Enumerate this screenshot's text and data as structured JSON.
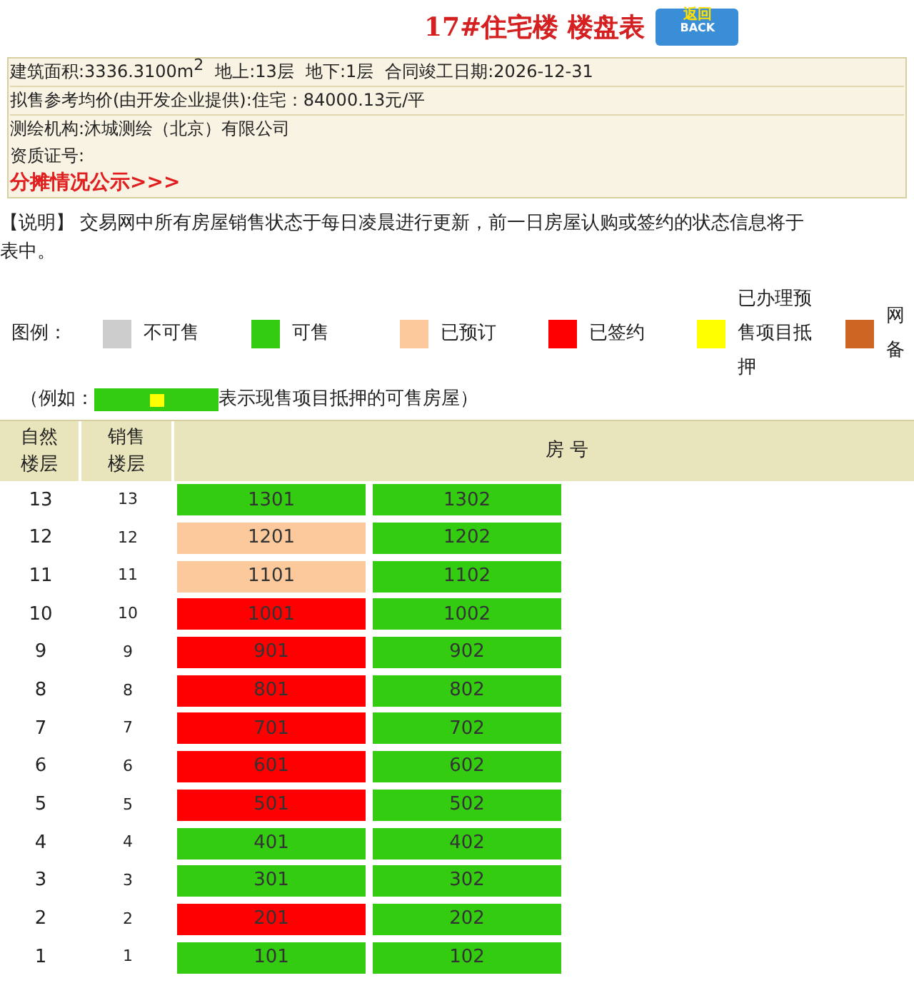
{
  "title": "17#住宅楼 楼盘表",
  "back_button": {
    "top": "返回",
    "bottom": "BACK"
  },
  "info": {
    "area_label": "建筑面积:3336.3100m",
    "area_sup": "2",
    "above": "地上:13层",
    "below": "地下:1层",
    "completion": "合同竣工日期:2026-12-31",
    "price": "拟售参考均价(由开发企业提供):住宅：84000.13元/平",
    "surveyor": "测绘机构:沐城测绘（北京）有限公司",
    "cert": "资质证号:",
    "link": "分摊情况公示>>>"
  },
  "notice": [
    "【说明】 交易网中所有房屋销售状态于每日凌晨进行更新，前一日房屋认购或签约的状态信息将于",
    "表中。"
  ],
  "legend": {
    "label": "图例：",
    "items": [
      {
        "label": "不可售",
        "color": "#cccccc"
      },
      {
        "label": "可售",
        "color": "#33cc11"
      },
      {
        "label": "已预订",
        "color": "#fbc99b"
      },
      {
        "label": "已签约",
        "color": "#ff0000"
      },
      {
        "label": "已办理预售项目抵押",
        "color": "#ffff00"
      },
      {
        "label": "网备",
        "color": "#cc6622"
      }
    ]
  },
  "example": {
    "prefix": "（例如：",
    "suffix": "表示现售项目抵押的可售房屋）"
  },
  "table": {
    "columns": [
      "自然楼层",
      "销售楼层",
      "房 号"
    ],
    "rows": [
      {
        "floor": "13",
        "sale_floor": "13",
        "rooms": [
          {
            "number": "1301",
            "color": "#33cc11"
          },
          {
            "number": "1302",
            "color": "#33cc11"
          }
        ]
      },
      {
        "floor": "12",
        "sale_floor": "12",
        "rooms": [
          {
            "number": "1201",
            "color": "#fbc99b"
          },
          {
            "number": "1202",
            "color": "#33cc11"
          }
        ]
      },
      {
        "floor": "11",
        "sale_floor": "11",
        "rooms": [
          {
            "number": "1101",
            "color": "#fbc99b"
          },
          {
            "number": "1102",
            "color": "#33cc11"
          }
        ]
      },
      {
        "floor": "10",
        "sale_floor": "10",
        "rooms": [
          {
            "number": "1001",
            "color": "#ff0000"
          },
          {
            "number": "1002",
            "color": "#33cc11"
          }
        ]
      },
      {
        "floor": "9",
        "sale_floor": "9",
        "rooms": [
          {
            "number": "901",
            "color": "#ff0000"
          },
          {
            "number": "902",
            "color": "#33cc11"
          }
        ]
      },
      {
        "floor": "8",
        "sale_floor": "8",
        "rooms": [
          {
            "number": "801",
            "color": "#ff0000"
          },
          {
            "number": "802",
            "color": "#33cc11"
          }
        ]
      },
      {
        "floor": "7",
        "sale_floor": "7",
        "rooms": [
          {
            "number": "701",
            "color": "#ff0000"
          },
          {
            "number": "702",
            "color": "#33cc11"
          }
        ]
      },
      {
        "floor": "6",
        "sale_floor": "6",
        "rooms": [
          {
            "number": "601",
            "color": "#ff0000"
          },
          {
            "number": "602",
            "color": "#33cc11"
          }
        ]
      },
      {
        "floor": "5",
        "sale_floor": "5",
        "rooms": [
          {
            "number": "501",
            "color": "#ff0000"
          },
          {
            "number": "502",
            "color": "#33cc11"
          }
        ]
      },
      {
        "floor": "4",
        "sale_floor": "4",
        "rooms": [
          {
            "number": "401",
            "color": "#33cc11"
          },
          {
            "number": "402",
            "color": "#33cc11"
          }
        ]
      },
      {
        "floor": "3",
        "sale_floor": "3",
        "rooms": [
          {
            "number": "301",
            "color": "#33cc11"
          },
          {
            "number": "302",
            "color": "#33cc11"
          }
        ]
      },
      {
        "floor": "2",
        "sale_floor": "2",
        "rooms": [
          {
            "number": "201",
            "color": "#ff0000"
          },
          {
            "number": "202",
            "color": "#33cc11"
          }
        ]
      },
      {
        "floor": "1",
        "sale_floor": "1",
        "rooms": [
          {
            "number": "101",
            "color": "#33cc11"
          },
          {
            "number": "102",
            "color": "#33cc11"
          }
        ]
      }
    ]
  }
}
